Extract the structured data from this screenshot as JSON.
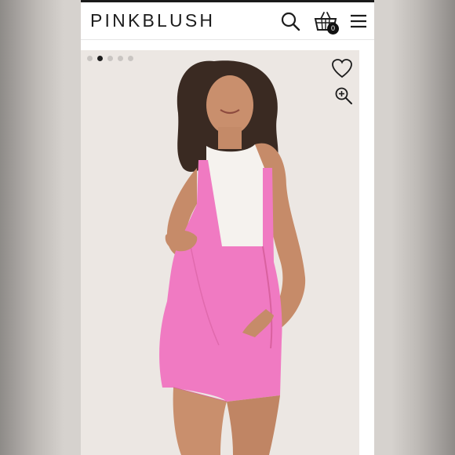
{
  "header": {
    "logo": "PINKBLUSH",
    "cart_count": "0",
    "icons": {
      "search": "search-icon",
      "cart": "shopping-basket-icon",
      "menu": "hamburger-menu-icon"
    }
  },
  "gallery": {
    "dot_count": 5,
    "active_index": 1,
    "icons": {
      "favorite": "heart-outline-icon",
      "zoom": "zoom-in-icon"
    },
    "product_color": "#f07ac2"
  }
}
